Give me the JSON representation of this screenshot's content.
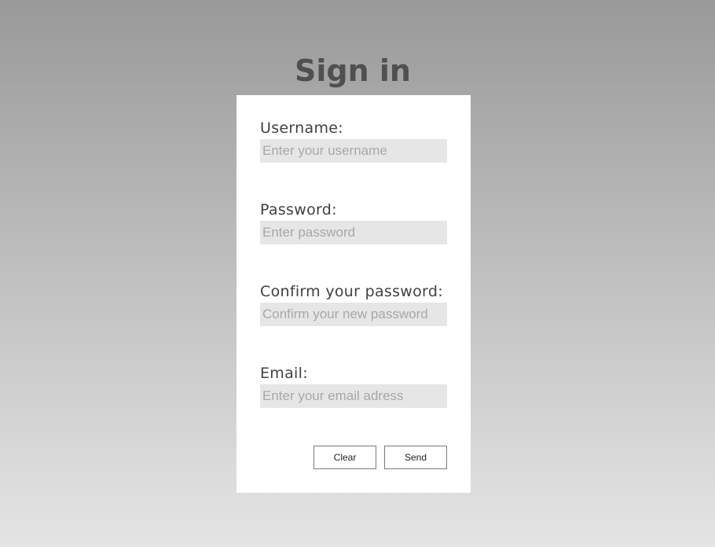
{
  "page": {
    "title": "Sign in"
  },
  "form": {
    "fields": [
      {
        "label": "Username:",
        "placeholder": "Enter your username",
        "type": "text"
      },
      {
        "label": "Password:",
        "placeholder": "Enter password",
        "type": "password"
      },
      {
        "label": "Confirm your password:",
        "placeholder": "Confirm your new password",
        "type": "password"
      },
      {
        "label": "Email:",
        "placeholder": "Enter your email adress",
        "type": "email"
      }
    ],
    "buttons": {
      "clear_label": "Clear",
      "send_label": "Send"
    }
  }
}
